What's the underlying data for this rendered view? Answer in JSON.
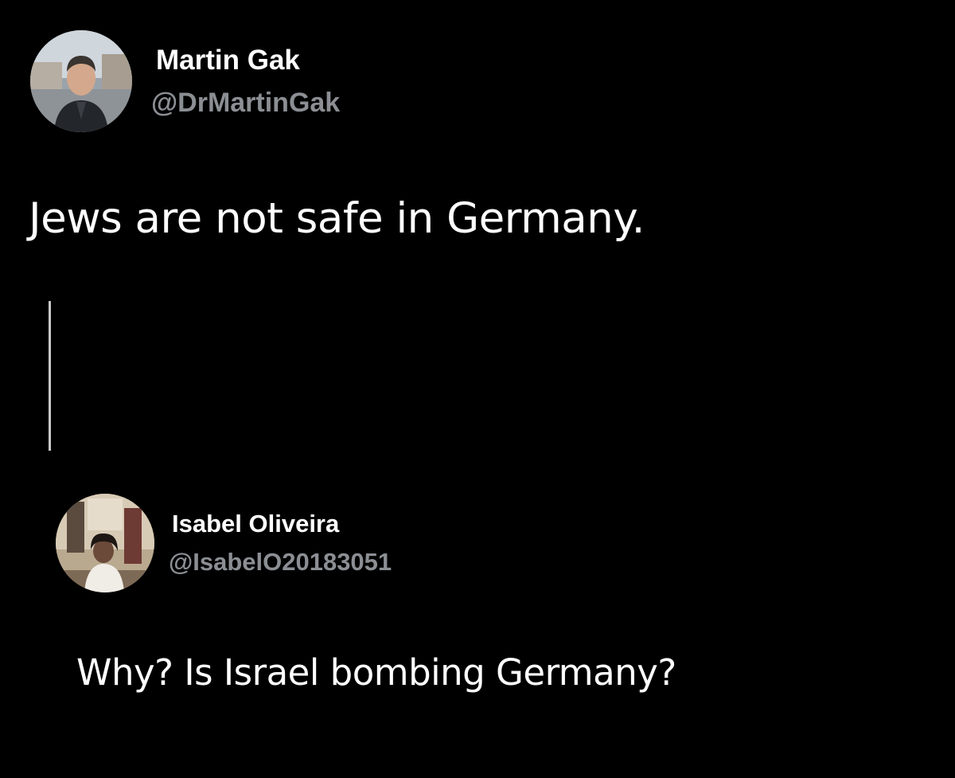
{
  "original_tweet": {
    "author_name": "Martin Gak",
    "author_handle": "@DrMartinGak",
    "text": "Jews are not safe in Germany."
  },
  "reply_tweet": {
    "author_name": "Isabel Oliveira",
    "author_handle": "@IsabelO20183051",
    "text": "Why? Is Israel bombing Germany?"
  },
  "colors": {
    "background": "#000000",
    "text_primary": "#ffffff",
    "text_secondary": "#8b8f94",
    "thread_line": "#c9c9c9"
  },
  "icons": {
    "avatar_1": "avatar-photo-man",
    "avatar_2": "avatar-photo-woman"
  }
}
